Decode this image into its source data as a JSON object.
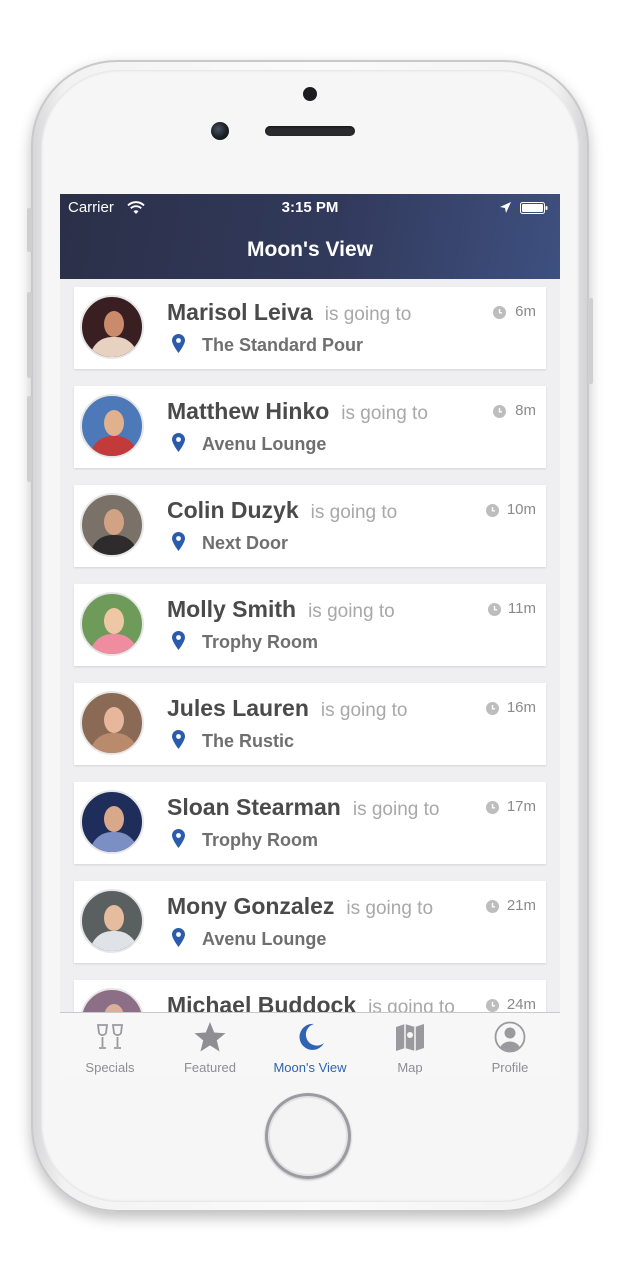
{
  "status_bar": {
    "carrier": "Carrier",
    "time": "3:15 PM"
  },
  "nav": {
    "title": "Moon's View"
  },
  "feed": {
    "going_text": "is going to",
    "items": [
      {
        "name": "Marisol Leiva",
        "venue": "The Standard Pour",
        "time": "6m"
      },
      {
        "name": "Matthew Hinko",
        "venue": "Avenu Lounge",
        "time": "8m"
      },
      {
        "name": "Colin Duzyk",
        "venue": "Next Door",
        "time": "10m"
      },
      {
        "name": "Molly Smith",
        "venue": "Trophy Room",
        "time": "11m"
      },
      {
        "name": "Jules Lauren",
        "venue": "The Rustic",
        "time": "16m"
      },
      {
        "name": "Sloan Stearman",
        "venue": "Trophy Room",
        "time": "17m"
      },
      {
        "name": "Mony Gonzalez",
        "venue": "Avenu Lounge",
        "time": "21m"
      },
      {
        "name": "Michael Buddock",
        "venue": "",
        "time": "24m"
      }
    ]
  },
  "tabbar": {
    "tabs": [
      {
        "label": "Specials",
        "icon": "wine-glasses-icon"
      },
      {
        "label": "Featured",
        "icon": "star-icon"
      },
      {
        "label": "Moon's View",
        "icon": "moon-icon",
        "active": true
      },
      {
        "label": "Map",
        "icon": "map-icon"
      },
      {
        "label": "Profile",
        "icon": "profile-icon"
      }
    ]
  },
  "colors": {
    "nav_gradient_start": "#2b3048",
    "nav_gradient_end": "#3e5080",
    "accent": "#2f63b3",
    "pin": "#2a5cab"
  }
}
